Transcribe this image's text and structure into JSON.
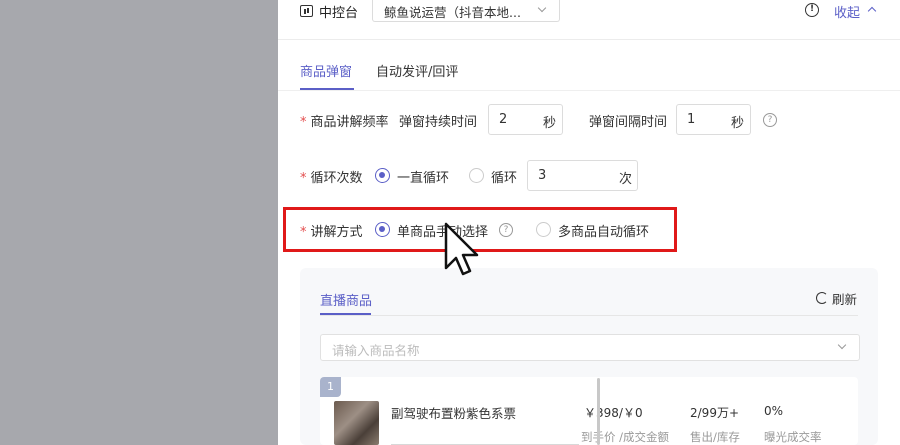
{
  "header": {
    "title": "中控台",
    "account_select": "鲸鱼说运营（抖音本地...",
    "collapse_label": "收起",
    "info_glyph": "!"
  },
  "tabs": [
    {
      "label": "商品弹窗",
      "active": true
    },
    {
      "label": "自动发评/回评",
      "active": false
    }
  ],
  "form": {
    "required_mark": "*",
    "frequency": {
      "label": "商品讲解频率",
      "duration_label": "弹窗持续时间",
      "duration_value": "2",
      "duration_unit": "秒",
      "interval_label": "弹窗间隔时间",
      "interval_value": "1",
      "interval_unit": "秒"
    },
    "loop": {
      "label": "循环次数",
      "option_forever": "一直循环",
      "option_count": "循环",
      "count_value": "3",
      "count_unit": "次",
      "selected": "forever"
    },
    "mode": {
      "label": "讲解方式",
      "option_manual": "单商品手动选择",
      "option_auto": "多商品自动循环",
      "selected": "manual"
    },
    "help_glyph": "?"
  },
  "products": {
    "tab_label": "直播商品",
    "refresh_label": "刷新",
    "search_placeholder": "请输入商品名称",
    "items": [
      {
        "index": "1",
        "name": "副驾驶布置粉紫色系票",
        "price": "￥398/￥0",
        "price_label": "到手价 /成交金额",
        "sales": "2/99万+",
        "sales_label": "售出/库存",
        "conversion": "0%",
        "conversion_label": "曝光成交率"
      }
    ]
  },
  "colors": {
    "accent": "#5b5fc7",
    "highlight": "#e01919",
    "required": "#e34d4d",
    "overlay": "#a7a8ad"
  }
}
